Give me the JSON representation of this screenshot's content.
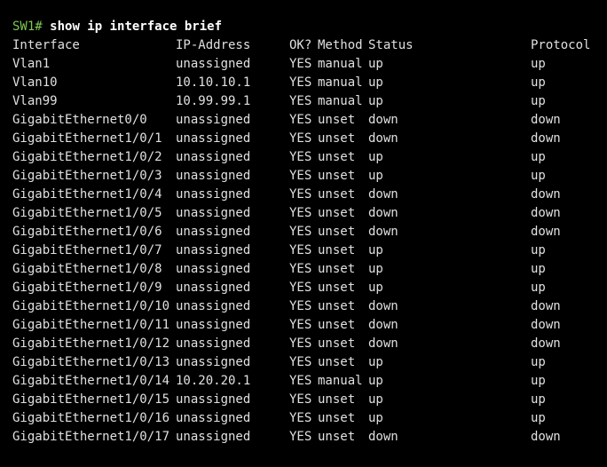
{
  "terminal": {
    "prompt": "SW1#",
    "command": "show ip interface brief",
    "headers": {
      "interface": "Interface",
      "ip": "IP-Address",
      "ok": "OK?",
      "method": "Method",
      "status": "Status",
      "protocol": "Protocol"
    },
    "rows": [
      {
        "interface": "Vlan1",
        "ip": "unassigned",
        "ok": "YES",
        "method": "manual",
        "status": "up",
        "protocol": "up"
      },
      {
        "interface": "Vlan10",
        "ip": "10.10.10.1",
        "ok": "YES",
        "method": "manual",
        "status": "up",
        "protocol": "up"
      },
      {
        "interface": "Vlan99",
        "ip": "10.99.99.1",
        "ok": "YES",
        "method": "manual",
        "status": "up",
        "protocol": "up"
      },
      {
        "interface": "GigabitEthernet0/0",
        "ip": "unassigned",
        "ok": "YES",
        "method": "unset",
        "status": "down",
        "protocol": "down"
      },
      {
        "interface": "GigabitEthernet1/0/1",
        "ip": "unassigned",
        "ok": "YES",
        "method": "unset",
        "status": "down",
        "protocol": "down"
      },
      {
        "interface": "GigabitEthernet1/0/2",
        "ip": "unassigned",
        "ok": "YES",
        "method": "unset",
        "status": "up",
        "protocol": "up"
      },
      {
        "interface": "GigabitEthernet1/0/3",
        "ip": "unassigned",
        "ok": "YES",
        "method": "unset",
        "status": "up",
        "protocol": "up"
      },
      {
        "interface": "GigabitEthernet1/0/4",
        "ip": "unassigned",
        "ok": "YES",
        "method": "unset",
        "status": "down",
        "protocol": "down"
      },
      {
        "interface": "GigabitEthernet1/0/5",
        "ip": "unassigned",
        "ok": "YES",
        "method": "unset",
        "status": "down",
        "protocol": "down"
      },
      {
        "interface": "GigabitEthernet1/0/6",
        "ip": "unassigned",
        "ok": "YES",
        "method": "unset",
        "status": "down",
        "protocol": "down"
      },
      {
        "interface": "GigabitEthernet1/0/7",
        "ip": "unassigned",
        "ok": "YES",
        "method": "unset",
        "status": "up",
        "protocol": "up"
      },
      {
        "interface": "GigabitEthernet1/0/8",
        "ip": "unassigned",
        "ok": "YES",
        "method": "unset",
        "status": "up",
        "protocol": "up"
      },
      {
        "interface": "GigabitEthernet1/0/9",
        "ip": "unassigned",
        "ok": "YES",
        "method": "unset",
        "status": "up",
        "protocol": "up"
      },
      {
        "interface": "GigabitEthernet1/0/10",
        "ip": "unassigned",
        "ok": "YES",
        "method": "unset",
        "status": "down",
        "protocol": "down"
      },
      {
        "interface": "GigabitEthernet1/0/11",
        "ip": "unassigned",
        "ok": "YES",
        "method": "unset",
        "status": "down",
        "protocol": "down"
      },
      {
        "interface": "GigabitEthernet1/0/12",
        "ip": "unassigned",
        "ok": "YES",
        "method": "unset",
        "status": "down",
        "protocol": "down"
      },
      {
        "interface": "GigabitEthernet1/0/13",
        "ip": "unassigned",
        "ok": "YES",
        "method": "unset",
        "status": "up",
        "protocol": "up"
      },
      {
        "interface": "GigabitEthernet1/0/14",
        "ip": "10.20.20.1",
        "ok": "YES",
        "method": "manual",
        "status": "up",
        "protocol": "up"
      },
      {
        "interface": "GigabitEthernet1/0/15",
        "ip": "unassigned",
        "ok": "YES",
        "method": "unset",
        "status": "up",
        "protocol": "up"
      },
      {
        "interface": "GigabitEthernet1/0/16",
        "ip": "unassigned",
        "ok": "YES",
        "method": "unset",
        "status": "up",
        "protocol": "up"
      },
      {
        "interface": "GigabitEthernet1/0/17",
        "ip": "unassigned",
        "ok": "YES",
        "method": "unset",
        "status": "down",
        "protocol": "down"
      }
    ]
  },
  "colors": {
    "background": "#000000",
    "text": "#e0e0e0",
    "prompt": "#7ec850",
    "command": "#ffffff"
  }
}
